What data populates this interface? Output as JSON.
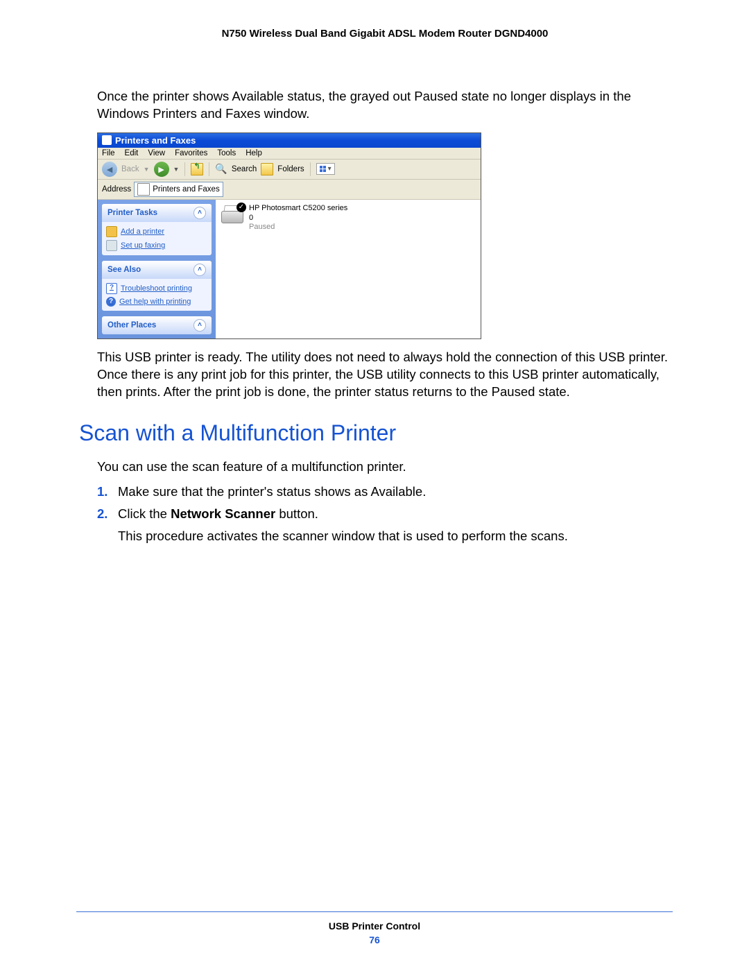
{
  "header": {
    "title": "N750 Wireless Dual Band Gigabit ADSL Modem Router DGND4000"
  },
  "intro_paragraph": "Once the printer shows Available status, the grayed out Paused state no longer displays in the Windows Printers and Faxes window.",
  "screenshot": {
    "titlebar": "Printers and Faxes",
    "menu": {
      "file": "File",
      "edit": "Edit",
      "view": "View",
      "favorites": "Favorites",
      "tools": "Tools",
      "help": "Help"
    },
    "toolbar": {
      "back": "Back",
      "search": "Search",
      "folders": "Folders"
    },
    "addressbar": {
      "label": "Address",
      "value": "Printers and Faxes"
    },
    "sidebar": {
      "printer_tasks": {
        "title": "Printer Tasks",
        "add_printer": "Add a printer",
        "set_up_faxing": "Set up faxing"
      },
      "see_also": {
        "title": "See Also",
        "troubleshoot": "Troubleshoot printing",
        "get_help": "Get help with printing"
      },
      "other_places": {
        "title": "Other Places"
      }
    },
    "content": {
      "printer_name": "HP Photosmart C5200 series",
      "jobs": "0",
      "status": "Paused"
    }
  },
  "usb_paragraph": "This USB printer is ready. The utility does not need to always hold the connection of this USB printer. Once there is any print job for this printer, the USB utility connects to this USB printer automatically, then prints. After the print job is done, the printer status returns to the Paused state.",
  "section_heading": "Scan with a Multifunction Printer",
  "section_intro": "You can use the scan feature of a multifunction printer.",
  "steps": {
    "s1": {
      "num": "1.",
      "text": "Make sure that the printer's status shows as Available."
    },
    "s2": {
      "num": "2.",
      "pre": "Click the ",
      "bold": "Network Scanner",
      "post": " button.",
      "sub": "This procedure activates the scanner window that is used to perform the scans."
    }
  },
  "footer": {
    "section": "USB Printer Control",
    "page": "76"
  }
}
